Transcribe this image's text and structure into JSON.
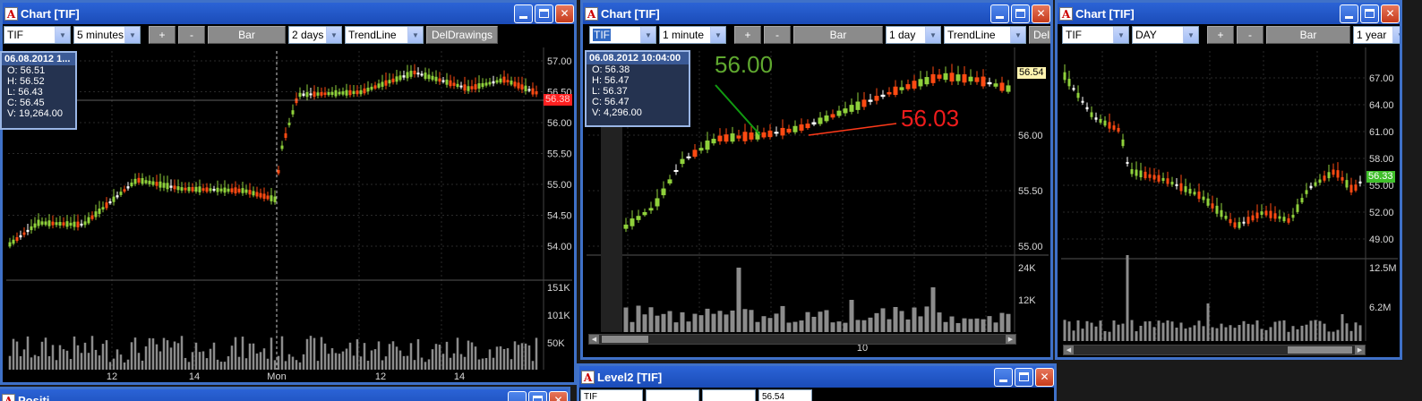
{
  "colors": {
    "up": "#8fd13b",
    "down": "#ff4a12",
    "doji": "#ffffff",
    "volume": "#8c8c8c",
    "grid": "#2a2a2a",
    "titlebar": "#1f57c8"
  },
  "windows": [
    {
      "title": "Chart [TIF]",
      "toolbar": {
        "symbol": "TIF",
        "interval": "5 minutes",
        "plus": "+",
        "minus": "-",
        "type": "Bar",
        "range": "2 days",
        "tool": "TrendLine",
        "action": "DelDrawings"
      },
      "info": {
        "header": "06.08.2012 1...",
        "open": "O: 56.51",
        "high": "H: 56.52",
        "low": "L: 56.43",
        "close": "C: 56.45",
        "volume": "V: 19,264.00"
      },
      "last_price": "56.38",
      "y_ticks": [
        "57.00",
        "56.50",
        "56.00",
        "55.50",
        "55.00",
        "54.50",
        "54.00"
      ],
      "vol_ticks": [
        "151K",
        "101K",
        "50K"
      ],
      "x_ticks": [
        "12",
        "14",
        "Mon",
        "12",
        "14"
      ]
    },
    {
      "title": "Chart [TIF]",
      "toolbar": {
        "symbol": "TIF",
        "interval": "1 minute",
        "plus": "+",
        "minus": "-",
        "type": "Bar",
        "range": "1 day",
        "tool": "TrendLine",
        "action": "DelDr"
      },
      "info": {
        "header": "06.08.2012 10:04:00",
        "open": "O: 56.38",
        "high": "H: 56.47",
        "low": "L: 56.37",
        "close": "C: 56.47",
        "volume": "V: 4,296.00"
      },
      "last_price": "56.54",
      "annotation_green": "56.00",
      "annotation_red": "56.03",
      "y_ticks": [
        "56.00",
        "55.50",
        "55.00"
      ],
      "vol_ticks": [
        "24K",
        "12K"
      ],
      "x_ticks": [
        "10"
      ]
    },
    {
      "title": "Chart [TIF]",
      "toolbar": {
        "symbol": "TIF",
        "interval": "DAY",
        "plus": "+",
        "minus": "-",
        "type": "Bar",
        "range": "1 year"
      },
      "last_price": "56.33",
      "y_ticks": [
        "67.00",
        "64.00",
        "61.00",
        "58.00",
        "55.00",
        "52.00",
        "49.00"
      ],
      "vol_ticks": [
        "12.5M",
        "6.2M"
      ]
    },
    {
      "title": "Level2 [TIF]",
      "toolbar": {
        "symbol": "TIF",
        "price": "56.54"
      }
    },
    {
      "title": "Positi..."
    }
  ]
}
